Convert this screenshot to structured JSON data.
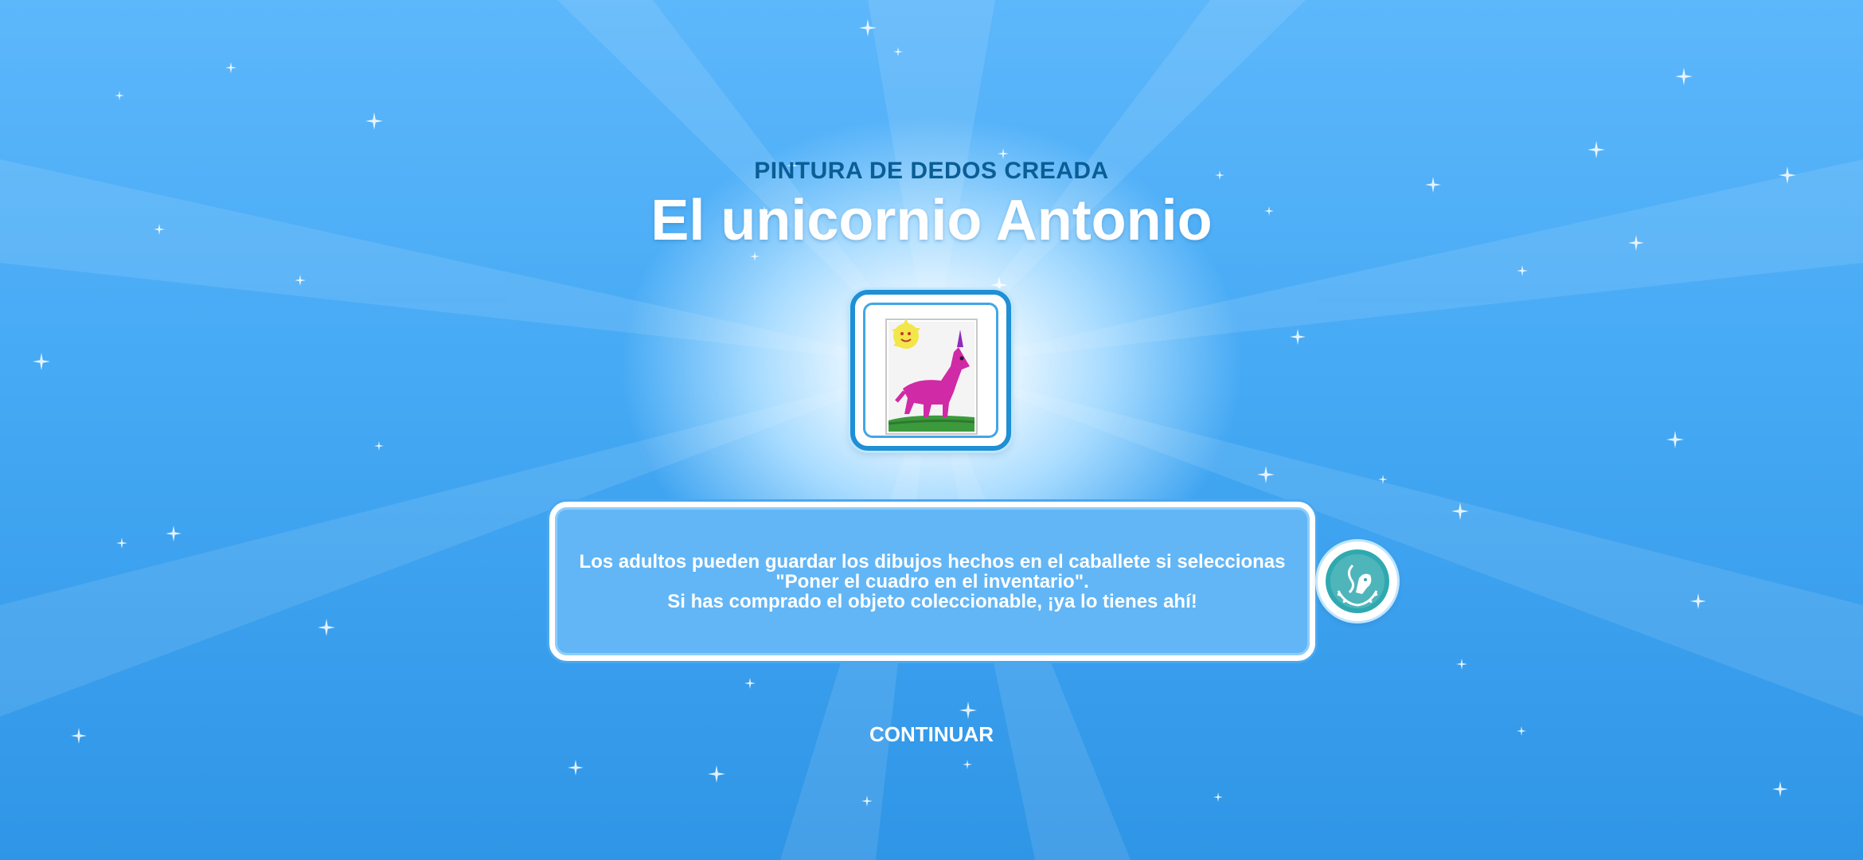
{
  "header": {
    "subtitle": "PINTURA DE DEDOS CREADA",
    "title": "El unicornio Antonio"
  },
  "message": {
    "lines": [
      "Los adultos pueden guardar los dibujos hechos en el caballete si seleccionas",
      "\"Poner el cuadro en el inventario\".",
      "Si has comprado el objeto coleccionable, ¡ya lo tienes ahí!"
    ]
  },
  "actions": {
    "continue_label": "CONTINUAR"
  },
  "icons": {
    "painting": "unicorn-finger-painting-icon",
    "badge": "easel-collectible-badge-icon"
  },
  "colors": {
    "background": "#45a9f4",
    "subtitle": "#0a5d95",
    "title": "#ffffff",
    "message_box": "#62b6f6",
    "frame": "#1f8fd6"
  }
}
